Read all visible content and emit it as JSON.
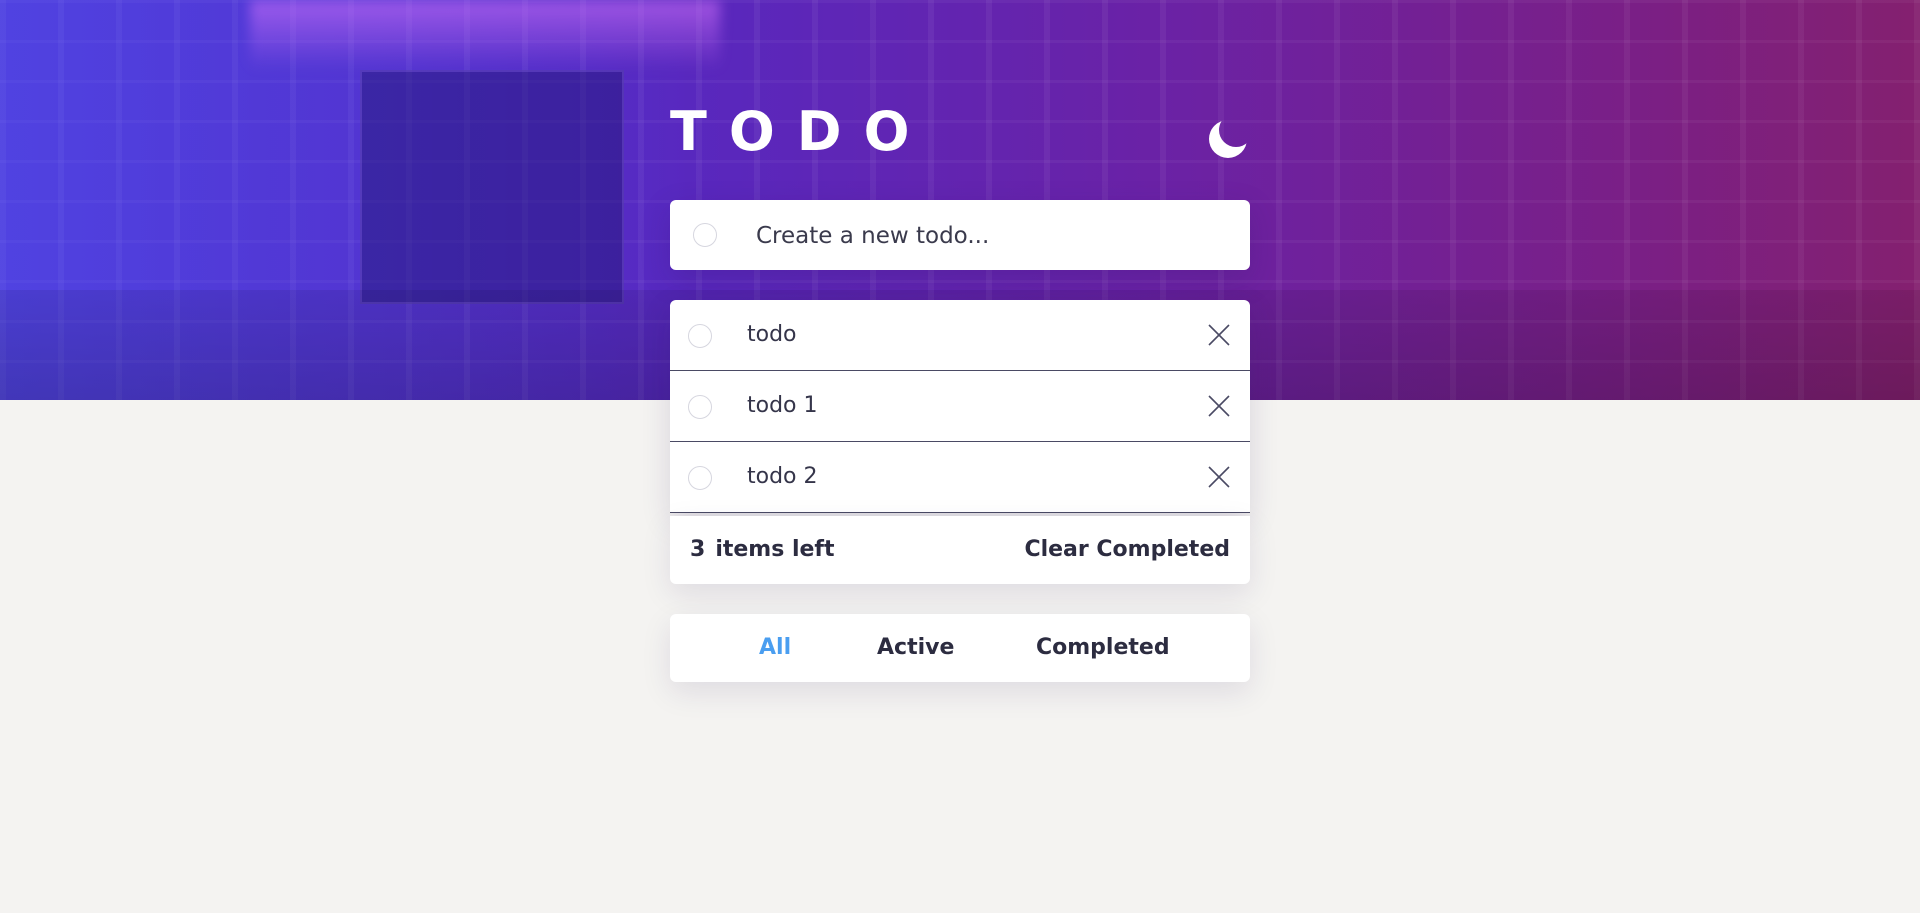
{
  "app": {
    "title": "TODO",
    "theme_toggle_icon": "moon-icon"
  },
  "new_todo": {
    "placeholder": "Create a new todo...",
    "value": ""
  },
  "todos": [
    {
      "text": "todo",
      "completed": false
    },
    {
      "text": "todo 1",
      "completed": false
    },
    {
      "text": "todo 2",
      "completed": false
    }
  ],
  "footer": {
    "items_left_count": "3",
    "items_left_label": "items left",
    "clear_completed_label": "Clear Completed"
  },
  "filters": {
    "all": "All",
    "active": "Active",
    "completed": "Completed",
    "selected": "all"
  },
  "colors": {
    "accent": "#4a9ef0",
    "text": "#2c2c40",
    "page_background": "#f4f3f1",
    "hero_gradient_start": "#4a2bd1",
    "hero_gradient_end": "#84206f"
  }
}
